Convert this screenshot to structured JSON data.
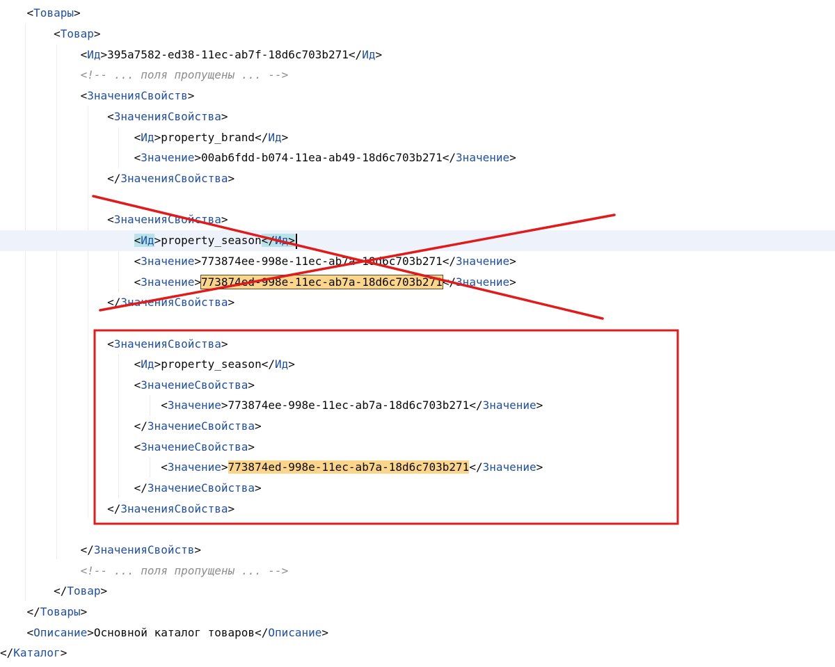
{
  "code": {
    "tag_tovary": "Товары",
    "tag_tovar": "Товар",
    "tag_id": "Ид",
    "id_value": "395a7582-ed38-11ec-ab7f-18d6c703b271",
    "comment_skipped": "<!-- ... поля пропущены ... -->",
    "tag_props": "ЗначенияСвойств",
    "tag_prop": "ЗначенияСвойства",
    "tag_value": "Значение",
    "tag_prop_value": "ЗначениеСвойства",
    "brand_id": "property_brand",
    "brand_value": "00ab6fdd-b074-11ea-ab49-18d6c703b271",
    "season_id": "property_season",
    "season_value_1": "773874ee-998e-11ec-ab7a-18d6c703b271",
    "season_value_2": "773874ed-998e-11ec-ab7a-18d6c703b271",
    "tag_description": "Описание",
    "description_text": "Основной каталог товаров",
    "tag_catalog": "Каталог"
  },
  "colors": {
    "tag": "#1f4ea8",
    "comment": "#8c8c8c",
    "highlight": "#fbd58a",
    "annotation_red": "#e01b1b",
    "current_line": "#eef3fb"
  }
}
